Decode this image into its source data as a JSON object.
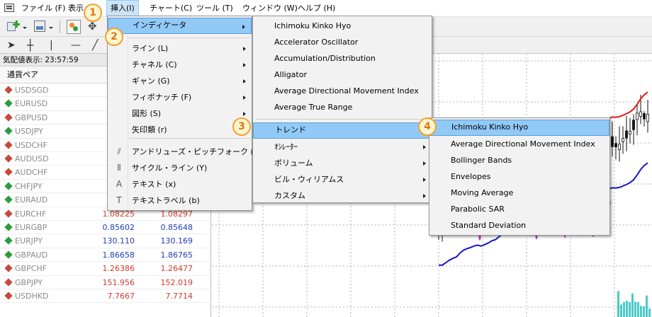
{
  "menubar": {
    "items": [
      {
        "label": "ファイル (F)"
      },
      {
        "label": "表示"
      },
      {
        "label": "挿入(I)"
      },
      {
        "label": "チャート(C)"
      },
      {
        "label": "ツール (T)"
      },
      {
        "label": "ウィンドウ (W)"
      },
      {
        "label": "ヘルプ (H)"
      }
    ]
  },
  "market_watch": {
    "title": "気配値表示: 23:57:59",
    "column_symbol": "通貨ペア",
    "rows": [
      {
        "symbol": "USDSGD",
        "dir": "down",
        "bid": "",
        "ask": ""
      },
      {
        "symbol": "EURUSD",
        "dir": "up",
        "bid": "",
        "ask": ""
      },
      {
        "symbol": "GBPUSD",
        "dir": "down",
        "bid": "",
        "ask": ""
      },
      {
        "symbol": "USDJPY",
        "dir": "up",
        "bid": "",
        "ask": ""
      },
      {
        "symbol": "USDCHF",
        "dir": "down",
        "bid": "",
        "ask": ""
      },
      {
        "symbol": "AUDUSD",
        "dir": "down",
        "bid": "",
        "ask": ""
      },
      {
        "symbol": "AUDCHF",
        "dir": "down",
        "bid": "",
        "ask": ""
      },
      {
        "symbol": "CHFJPY",
        "dir": "up",
        "bid": "",
        "ask": ""
      },
      {
        "symbol": "EURAUD",
        "dir": "up",
        "bid": "",
        "ask": ""
      },
      {
        "symbol": "EURCHF",
        "dir": "down",
        "bid": "1.08225",
        "ask": "1.08297"
      },
      {
        "symbol": "EURGBP",
        "dir": "up",
        "bid": "0.85602",
        "ask": "0.85648"
      },
      {
        "symbol": "EURJPY",
        "dir": "up",
        "bid": "130.110",
        "ask": "130.169"
      },
      {
        "symbol": "GBPAUD",
        "dir": "up",
        "bid": "1.86658",
        "ask": "1.86765"
      },
      {
        "symbol": "GBPCHF",
        "dir": "down",
        "bid": "1.26386",
        "ask": "1.26477"
      },
      {
        "symbol": "GBPJPY",
        "dir": "down",
        "bid": "151.956",
        "ask": "152.019"
      },
      {
        "symbol": "USDHKD",
        "dir": "down",
        "bid": "7.7667",
        "ask": "7.7714"
      }
    ]
  },
  "insert_menu": {
    "items": [
      {
        "label": "インディケータ",
        "submenu": true,
        "icon": ""
      },
      {
        "label": "ライン (L)",
        "submenu": true,
        "icon": ""
      },
      {
        "label": "チャネル (C)",
        "submenu": true,
        "icon": ""
      },
      {
        "label": "ギャン (G)",
        "submenu": true,
        "icon": ""
      },
      {
        "label": "フィボナッチ (F)",
        "submenu": true,
        "icon": ""
      },
      {
        "label": "図形 (S)",
        "submenu": true,
        "icon": ""
      },
      {
        "label": "矢印類 (r)",
        "submenu": false,
        "icon": ""
      },
      {
        "label": "アンドリューズ・ピッチフォーク (A)",
        "submenu": false,
        "icon": "pitchfork-icon"
      },
      {
        "label": "サイクル・ライン (Y)",
        "submenu": false,
        "icon": "cycle-lines-icon"
      },
      {
        "label": "テキスト (x)",
        "submenu": false,
        "icon": "text-icon"
      },
      {
        "label": "テキストラベル (b)",
        "submenu": false,
        "icon": "text-label-icon"
      }
    ]
  },
  "indicator_menu": {
    "items": [
      {
        "label": "Ichimoku Kinko Hyo",
        "submenu": false
      },
      {
        "label": "Accelerator Oscillator",
        "submenu": false
      },
      {
        "label": "Accumulation/Distribution",
        "submenu": false
      },
      {
        "label": "Alligator",
        "submenu": false
      },
      {
        "label": "Average Directional Movement Index",
        "submenu": false
      },
      {
        "label": "Average True Range",
        "submenu": false
      },
      {
        "label": "トレンド",
        "submenu": true
      },
      {
        "label": "ｵｼﾚｰﾀｰ",
        "submenu": true
      },
      {
        "label": "ボリューム",
        "submenu": true
      },
      {
        "label": "ビル・ウィリアムス",
        "submenu": true
      },
      {
        "label": "カスタム",
        "submenu": true
      }
    ]
  },
  "trend_menu": {
    "items": [
      {
        "label": "Ichimoku Kinko Hyo"
      },
      {
        "label": "Average Directional Movement Index"
      },
      {
        "label": "Bollinger Bands"
      },
      {
        "label": "Envelopes"
      },
      {
        "label": "Moving Average"
      },
      {
        "label": "Parabolic SAR"
      },
      {
        "label": "Standard Deviation"
      }
    ]
  },
  "callouts": [
    "1",
    "2",
    "3",
    "4"
  ],
  "colors": {
    "menu_highlight": "#91c9f7",
    "callout_border": "#f6a02d",
    "up_arrow": "#2d9b3e",
    "down_arrow": "#c9483a",
    "chart_red": "#e01818",
    "chart_blue": "#1414c8",
    "chart_magenta": "#c03cc0",
    "chart_aqua": "#4ec9c9"
  }
}
